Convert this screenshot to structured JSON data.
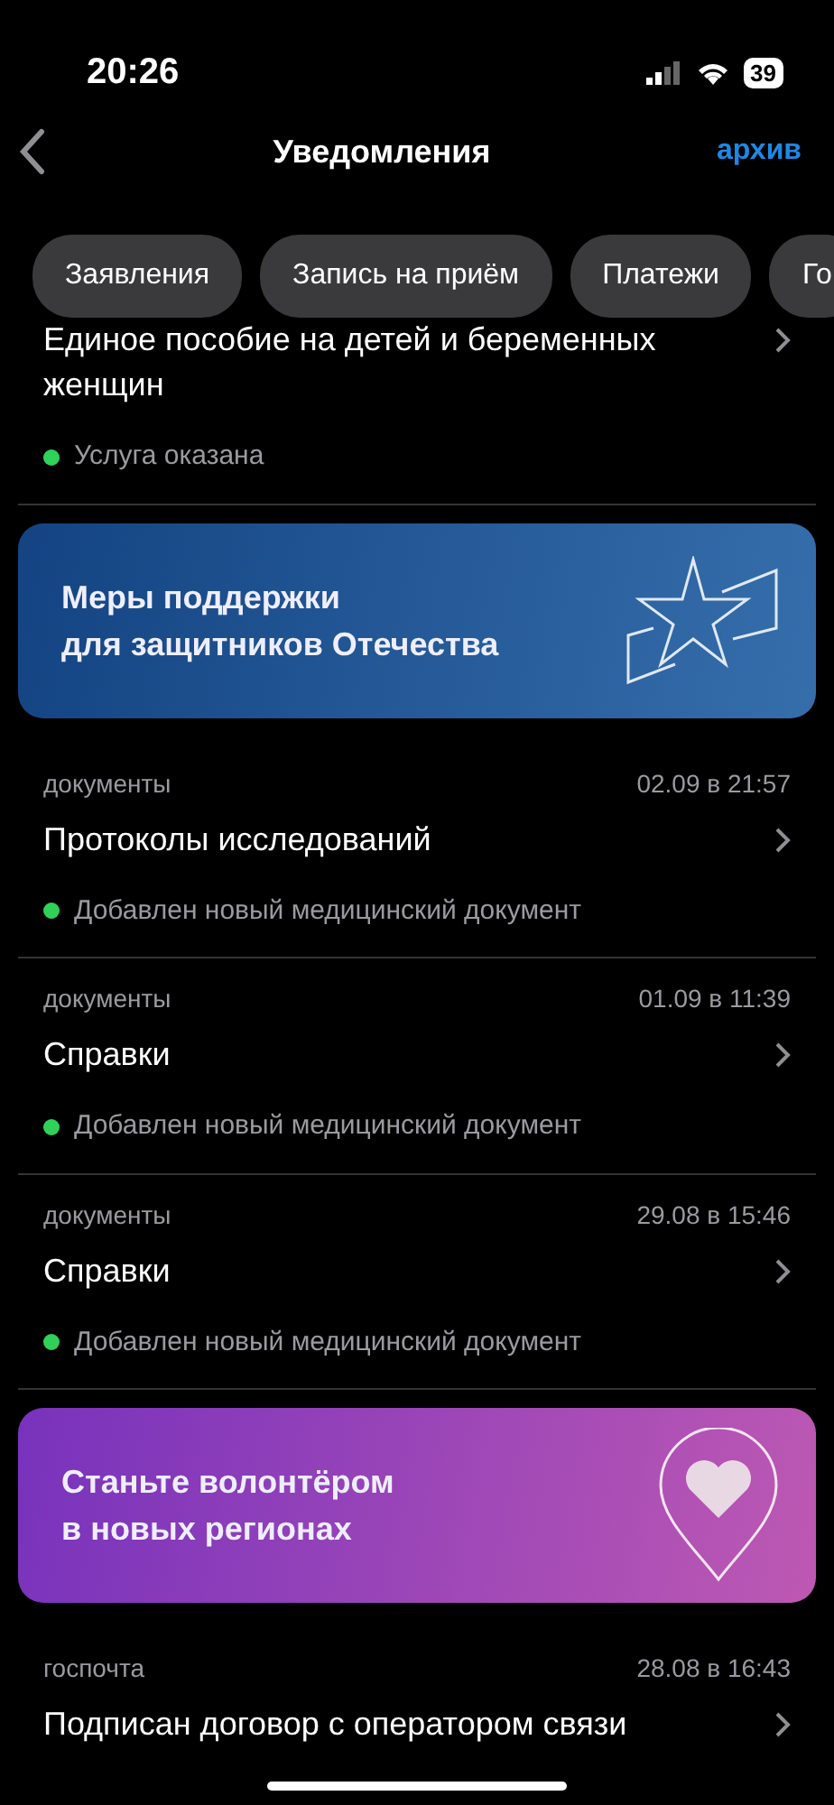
{
  "status_bar": {
    "time": "20:26",
    "battery": "39"
  },
  "header": {
    "title": "Уведомления",
    "action": "архив"
  },
  "chips": [
    {
      "label": "Заявления"
    },
    {
      "label": "Запись на приём"
    },
    {
      "label": "Платежи"
    },
    {
      "label": "Го"
    }
  ],
  "feed": [
    {
      "kind": "notification",
      "title": "Единое пособие на детей и беременных женщин",
      "status": "Услуга оказана",
      "color": "#30d158"
    },
    {
      "kind": "starbanner",
      "text": "Меры поддержки\nдля защитников Отечества",
      "color": "#1a5aa0"
    },
    {
      "kind": "notification",
      "category": "документы",
      "date": "02.09 в 21:57",
      "title": "Протоколы исследований",
      "status": "Добавлен новый медицинский документ",
      "color": "#30d158"
    },
    {
      "kind": "notification",
      "category": "документы",
      "date": "01.09 в 11:39",
      "title": "Справки",
      "status": "Добавлен новый медицинский документ",
      "color": "#30d158"
    },
    {
      "kind": "notification",
      "category": "документы",
      "date": "29.08 в 15:46",
      "title": "Справки",
      "status": "Добавлен новый медицинский документ",
      "color": "#30d158"
    },
    {
      "kind": "heartbanner",
      "text": "Станьте волонтёром\nв новых регионах",
      "color": "#9a48c8"
    },
    {
      "kind": "notification",
      "category": "госпочта",
      "date": "28.08 в 16:43",
      "title": "Подписан договор с оператором связи"
    }
  ]
}
